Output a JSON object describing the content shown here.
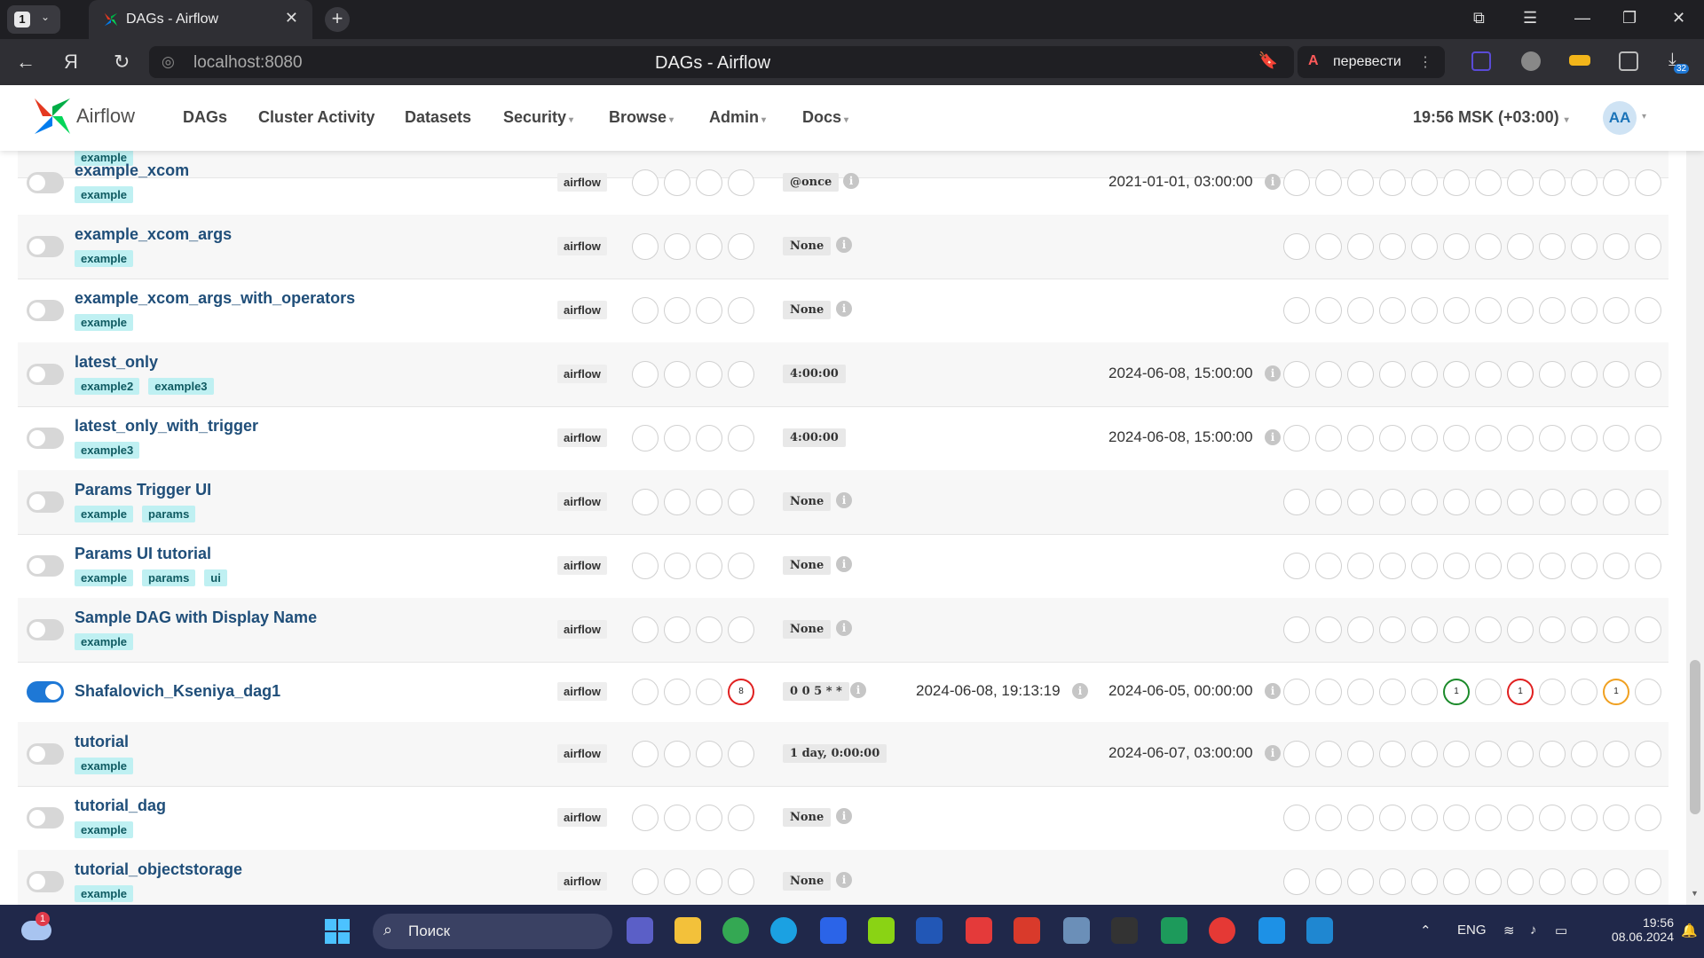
{
  "browser": {
    "tab_count": "1",
    "tab_title": "DAGs - Airflow",
    "url": "localhost:8080",
    "page_title": "DAGs - Airflow",
    "translate_label": "перевести",
    "downloads_badge": "32"
  },
  "airflow": {
    "brand": "Airflow",
    "nav": [
      "DAGs",
      "Cluster Activity",
      "Datasets",
      "Security",
      "Browse",
      "Admin",
      "Docs"
    ],
    "clock": "19:56 MSK (+03:00)",
    "avatar": "AA"
  },
  "rows": [
    {
      "name": "example_xcom",
      "tags": [
        "example"
      ],
      "owner": "airflow",
      "schedule": "@once",
      "last_run": "",
      "next_run": "2021-01-01, 03:00:00",
      "enabled": false
    },
    {
      "name": "example_xcom_args",
      "tags": [
        "example"
      ],
      "owner": "airflow",
      "schedule": "None",
      "last_run": "",
      "next_run": "",
      "enabled": false
    },
    {
      "name": "example_xcom_args_with_operators",
      "tags": [
        "example"
      ],
      "owner": "airflow",
      "schedule": "None",
      "last_run": "",
      "next_run": "",
      "enabled": false
    },
    {
      "name": "latest_only",
      "tags": [
        "example2",
        "example3"
      ],
      "owner": "airflow",
      "schedule": "4:00:00",
      "last_run": "",
      "next_run": "2024-06-08, 15:00:00",
      "enabled": false
    },
    {
      "name": "latest_only_with_trigger",
      "tags": [
        "example3"
      ],
      "owner": "airflow",
      "schedule": "4:00:00",
      "last_run": "",
      "next_run": "2024-06-08, 15:00:00",
      "enabled": false
    },
    {
      "name": "Params Trigger UI",
      "tags": [
        "example",
        "params"
      ],
      "owner": "airflow",
      "schedule": "None",
      "last_run": "",
      "next_run": "",
      "enabled": false
    },
    {
      "name": "Params UI tutorial",
      "tags": [
        "example",
        "params",
        "ui"
      ],
      "owner": "airflow",
      "schedule": "None",
      "last_run": "",
      "next_run": "",
      "enabled": false
    },
    {
      "name": "Sample DAG with Display Name",
      "tags": [
        "example"
      ],
      "owner": "airflow",
      "schedule": "None",
      "last_run": "",
      "next_run": "",
      "enabled": false
    },
    {
      "name": "Shafalovich_Kseniya_dag1",
      "tags": [],
      "owner": "airflow",
      "schedule": "0 0 5 * *",
      "last_run": "2024-06-08, 19:13:19",
      "next_run": "2024-06-05, 00:00:00",
      "enabled": true,
      "run_badge": "8",
      "task_badges": [
        {
          "pos": 5,
          "count": "1",
          "color": "#1b8a2a"
        },
        {
          "pos": 7,
          "count": "1",
          "color": "#e02020"
        },
        {
          "pos": 10,
          "count": "1",
          "color": "#f0a020"
        }
      ]
    },
    {
      "name": "tutorial",
      "tags": [
        "example"
      ],
      "owner": "airflow",
      "schedule": "1 day, 0:00:00",
      "last_run": "",
      "next_run": "2024-06-07, 03:00:00",
      "enabled": false
    },
    {
      "name": "tutorial_dag",
      "tags": [
        "example"
      ],
      "owner": "airflow",
      "schedule": "None",
      "last_run": "",
      "next_run": "",
      "enabled": false
    },
    {
      "name": "tutorial_objectstorage",
      "tags": [
        "example"
      ],
      "owner": "airflow",
      "schedule": "None",
      "last_run": "",
      "next_run": "",
      "enabled": false
    }
  ],
  "partial_top_row_tag": "example",
  "taskbar": {
    "search_placeholder": "Поиск",
    "lang": "ENG",
    "time": "19:56",
    "date": "08.06.2024",
    "notif_badge": "1"
  }
}
